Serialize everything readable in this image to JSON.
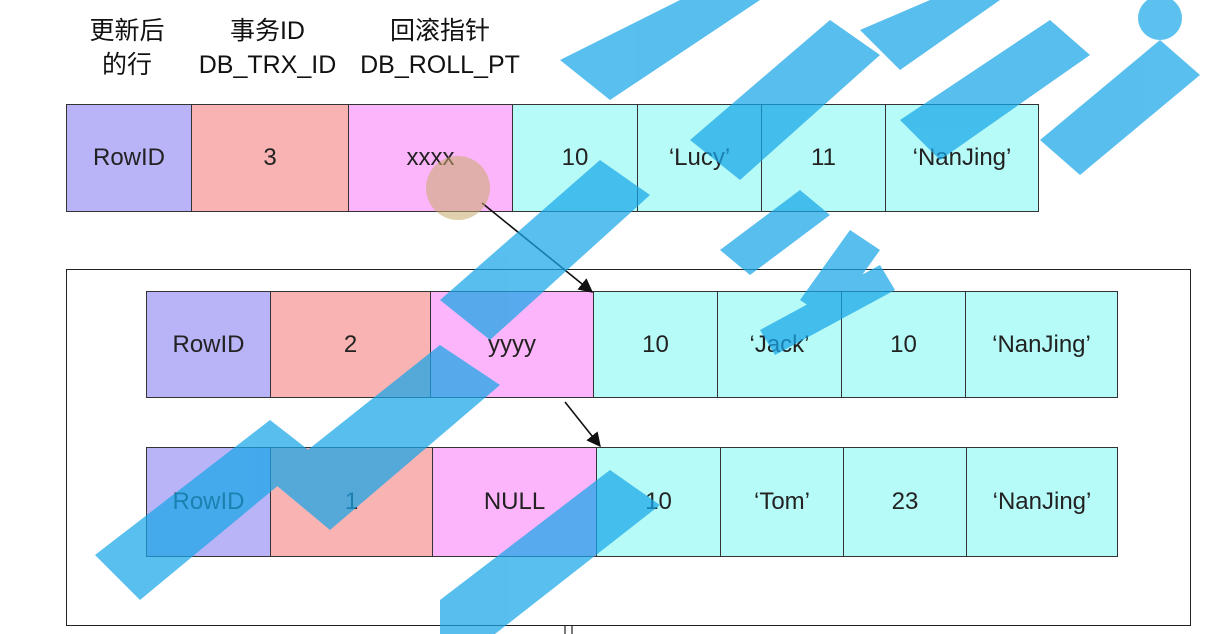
{
  "headers": {
    "row": [
      "更新后",
      "的行"
    ],
    "trx": [
      "事务ID",
      "DB_TRX_ID"
    ],
    "roll": [
      "回滚指针",
      "DB_ROLL_PT"
    ]
  },
  "rows": [
    {
      "cells": [
        "RowID",
        "3",
        "xxxx",
        "10",
        "‘Lucy’",
        "11",
        "‘NanJing’"
      ]
    },
    {
      "cells": [
        "RowID",
        "2",
        "yyyy",
        "10",
        "‘Jack’",
        "10",
        "‘NanJing’"
      ]
    },
    {
      "cells": [
        "RowID",
        "1",
        "NULL",
        "10",
        "‘Tom’",
        "23",
        "‘NanJing’"
      ]
    }
  ],
  "colors": {
    "rowid": "#b9b3f7",
    "trx": "#f9b3b3",
    "roll": "#fcb5fa",
    "value": "#b6fbf7",
    "watermark": "#17a6e8"
  }
}
